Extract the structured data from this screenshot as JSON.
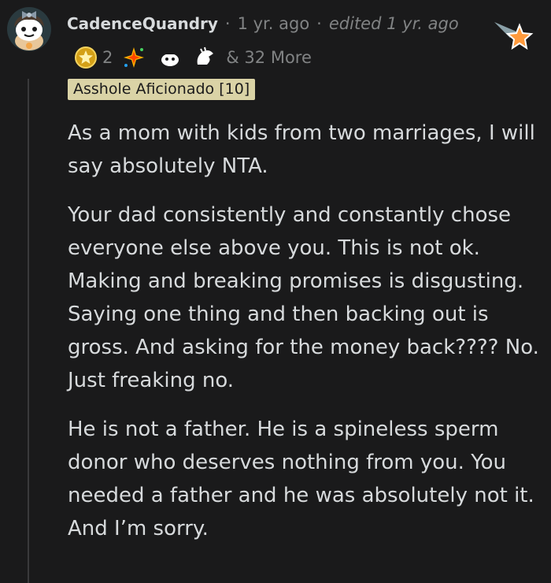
{
  "comment": {
    "username": "CadenceQuandry",
    "separator": "·",
    "time": "1 yr. ago",
    "edited": "edited 1 yr. ago",
    "flair": "Asshole Aficionado [10]",
    "awards": [
      {
        "icon": "gold-star-medal-icon",
        "count": "2"
      },
      {
        "icon": "sparkle-burst-icon",
        "count": ""
      },
      {
        "icon": "snoo-face-icon",
        "count": ""
      },
      {
        "icon": "hand-wave-icon",
        "count": ""
      }
    ],
    "awards_more": "& 32 More",
    "paragraphs": [
      "As a mom with kids from two marriages, I will say absolutely NTA.",
      "Your dad consistently and constantly chose everyone else above you. This is not ok. Making and breaking promises is disgusting. Saying one thing and then backing out is gross. And asking for the money back???? No. Just freaking no.",
      "He is not a father. He is a spineless sperm donor who deserves nothing from you. You needed a father and he was absolutely not it. And I’m sorry."
    ]
  },
  "colors": {
    "background": "#1a1a1b",
    "text": "#d7dadc",
    "muted": "#818384",
    "flair_bg": "#dad3a6"
  },
  "icons": {
    "avatar": "snoo-avatar-with-bow",
    "corner": "op-star-badge-icon"
  }
}
